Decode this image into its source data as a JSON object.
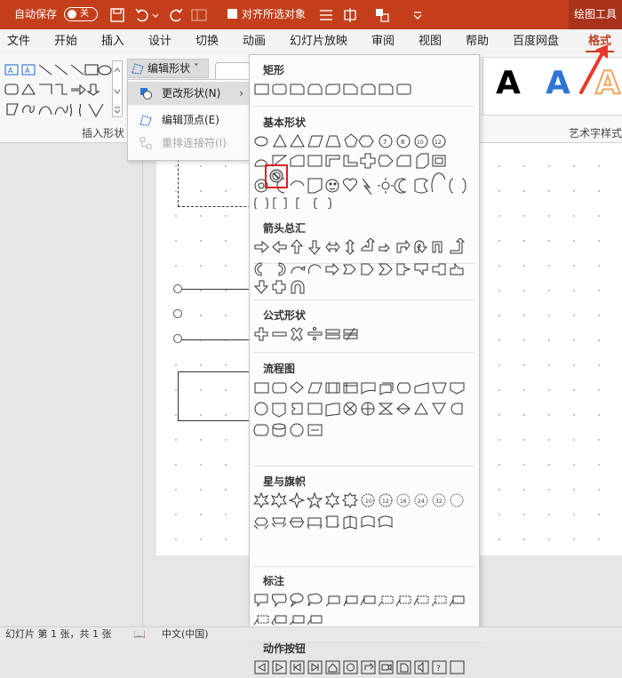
{
  "titlebar": {
    "autosave_label": "自动保存",
    "autosave_state": "关",
    "align_label": "对齐所选对象",
    "context_tab": "绘图工具"
  },
  "menu_tabs": [
    {
      "label": "文件"
    },
    {
      "label": "开始"
    },
    {
      "label": "插入"
    },
    {
      "label": "设计"
    },
    {
      "label": "切换"
    },
    {
      "label": "动画"
    },
    {
      "label": "幻灯片放映"
    },
    {
      "label": "审阅"
    },
    {
      "label": "视图"
    },
    {
      "label": "帮助"
    },
    {
      "label": "百度网盘"
    },
    {
      "label": "格式"
    }
  ],
  "ribbon": {
    "insert_shapes_group": "插入形状",
    "edit_shape_button": "编辑形状",
    "wordart_group": "艺术字样式",
    "wordart_letter": "A",
    "wordart_colors": [
      "#000000",
      "#2e75d6",
      "#f4a460"
    ]
  },
  "edit_shape_menu": {
    "items": [
      {
        "label": "更改形状(N)",
        "icon": "change-shape-icon",
        "state": "highlighted"
      },
      {
        "label": "编辑顶点(E)",
        "icon": "edit-points-icon",
        "state": "normal"
      },
      {
        "label": "重排连接符(I)",
        "icon": "reroute-connectors-icon",
        "state": "disabled"
      }
    ]
  },
  "shape_categories": [
    {
      "name": "矩形"
    },
    {
      "name": "基本形状"
    },
    {
      "name": "箭头总汇"
    },
    {
      "name": "公式形状"
    },
    {
      "name": "流程图"
    },
    {
      "name": "星与旗帜"
    },
    {
      "name": "标注"
    },
    {
      "name": "动作按钮"
    }
  ],
  "selected_shape": "no-symbol",
  "statusbar": {
    "slide_info": "幻灯片 第 1 张，共 1 张",
    "language": "中文(中国)"
  },
  "colors": {
    "accent": "#c43e1c",
    "highlight_box": "#e02020"
  }
}
